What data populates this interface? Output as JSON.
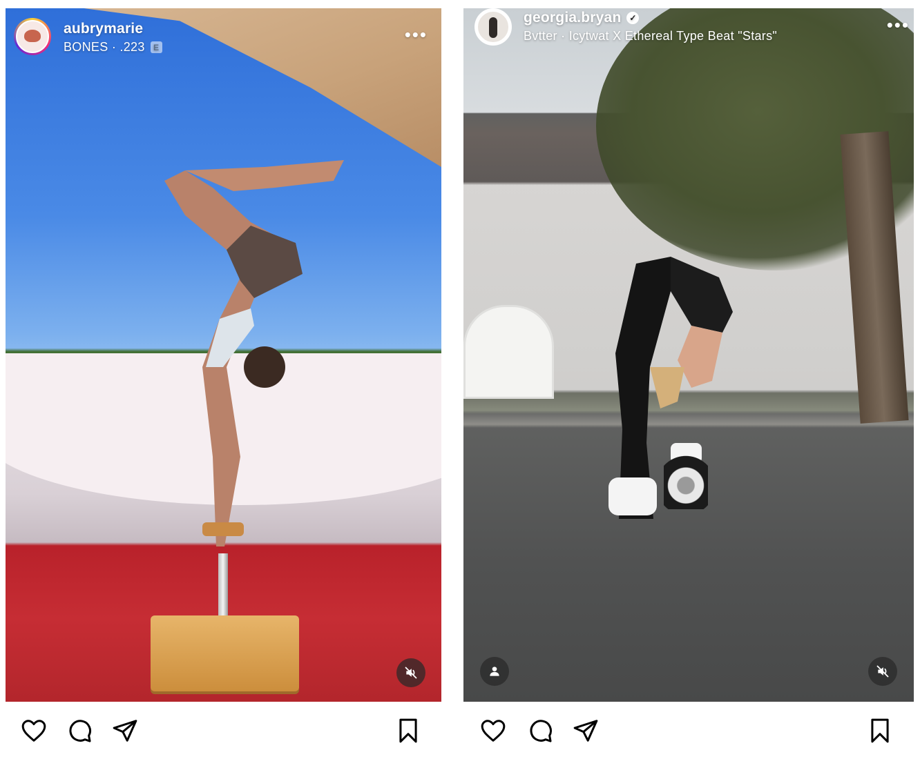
{
  "posts": [
    {
      "username": "aubrymarie",
      "verified": false,
      "audio": "BONES · .223",
      "explicit_badge": "E",
      "media": "handstand on wooden stand under awning",
      "sound_status": "muted"
    },
    {
      "username": "georgia.bryan",
      "verified": true,
      "audio": "Bvtter · Icytwat X Ethereal Type Beat \"Stars\"",
      "media": "backbend on hoverboard in front of house",
      "sound_status": "muted",
      "tagged_people": true
    }
  ],
  "icons": {
    "like": "heart-icon",
    "comment": "comment-icon",
    "share": "send-icon",
    "save": "bookmark-icon",
    "more": "more-dots-icon",
    "mute": "muted-speaker-icon",
    "tagged": "person-icon"
  },
  "colors": {
    "text_on_media": "#ffffff",
    "icons": "#000000",
    "badge_background": "#2a2a2a"
  }
}
